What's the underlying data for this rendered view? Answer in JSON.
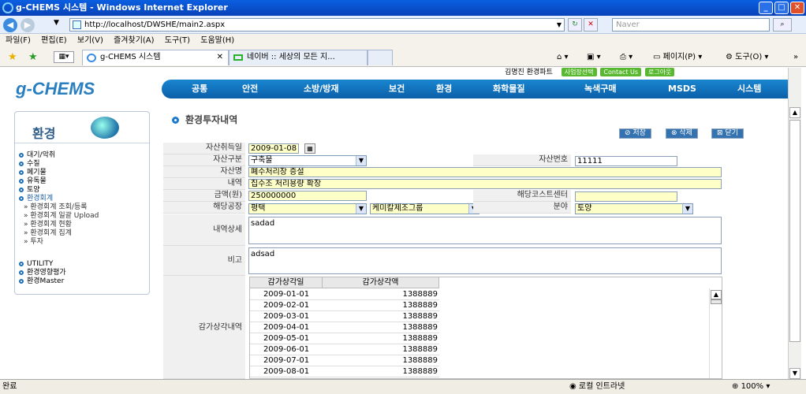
{
  "window": {
    "title": "g-CHEMS 시스템 - Windows Internet Explorer"
  },
  "address": {
    "url": "http://localhost/DWSHE/main2.aspx",
    "search_placeholder": "Naver"
  },
  "menubar": [
    "파일(F)",
    "편집(E)",
    "보기(V)",
    "즐겨찾기(A)",
    "도구(T)",
    "도움말(H)"
  ],
  "tabs": [
    {
      "label": "g-CHEMS 시스템"
    },
    {
      "label": "네이버 :: 세상의 모든 지..."
    }
  ],
  "tab_tools": {
    "page": "페이지(P)",
    "tools": "도구(O)"
  },
  "header": {
    "user": "김명진 환경파트",
    "buttons": [
      {
        "label": "사업장선택",
        "color": "#58b830"
      },
      {
        "label": "Contact Us",
        "color": "#58b830"
      },
      {
        "label": "로그아웃",
        "color": "#58b830"
      }
    ],
    "logo": "g-CHEMS"
  },
  "nav": [
    "공통",
    "안전",
    "소방/방재",
    "보건",
    "환경",
    "화학물질",
    "녹색구매",
    "MSDS",
    "시스템"
  ],
  "sidebar": {
    "title": "환경",
    "items": [
      "대기/악취",
      "수질",
      "폐기물",
      "유독물",
      "토양",
      "환경회계"
    ],
    "subitems": [
      "환경회계 조회/등록",
      "환경회계 일괄 Upload",
      "환경회계 현황",
      "환경회계 집계",
      "투자"
    ],
    "items2": [
      "UTILITY",
      "환경영향평가",
      "환경Master"
    ]
  },
  "page": {
    "title": "환경투자내역"
  },
  "actions": {
    "save": "저장",
    "delete": "삭제",
    "close": "닫기"
  },
  "form": {
    "acq_date_label": "자산취득일",
    "acq_date": "2009-01-08",
    "asset_type_label": "자산구분",
    "asset_type": "구축물",
    "asset_no_label": "자산번호",
    "asset_no": "11111",
    "asset_name_label": "자산명",
    "asset_name": "폐수처리장 증설",
    "desc_label": "내역",
    "desc": "집수조 처리용량 확장",
    "amount_label": "금액(원)",
    "amount": "250000000",
    "cost_center_label": "해당코스트센터",
    "cost_center": "",
    "plant_label": "해당공장",
    "plant": "평택",
    "plant2": "케미칼제조그룹",
    "field_label": "분야",
    "field": "토양",
    "detail_label": "내역상세",
    "detail": "sadad",
    "remark_label": "비고",
    "remark": "adsad",
    "dep_label": "감가상각내역"
  },
  "depreciation": {
    "headers": [
      "감가상각일",
      "감가상각액"
    ],
    "rows": [
      [
        "2009-01-01",
        "1388889"
      ],
      [
        "2009-02-01",
        "1388889"
      ],
      [
        "2009-03-01",
        "1388889"
      ],
      [
        "2009-04-01",
        "1388889"
      ],
      [
        "2009-05-01",
        "1388889"
      ],
      [
        "2009-06-01",
        "1388889"
      ],
      [
        "2009-07-01",
        "1388889"
      ],
      [
        "2009-08-01",
        "1388889"
      ]
    ]
  },
  "status": {
    "left": "완료",
    "zone": "로컬 인트라넷",
    "zoom": "100%"
  }
}
